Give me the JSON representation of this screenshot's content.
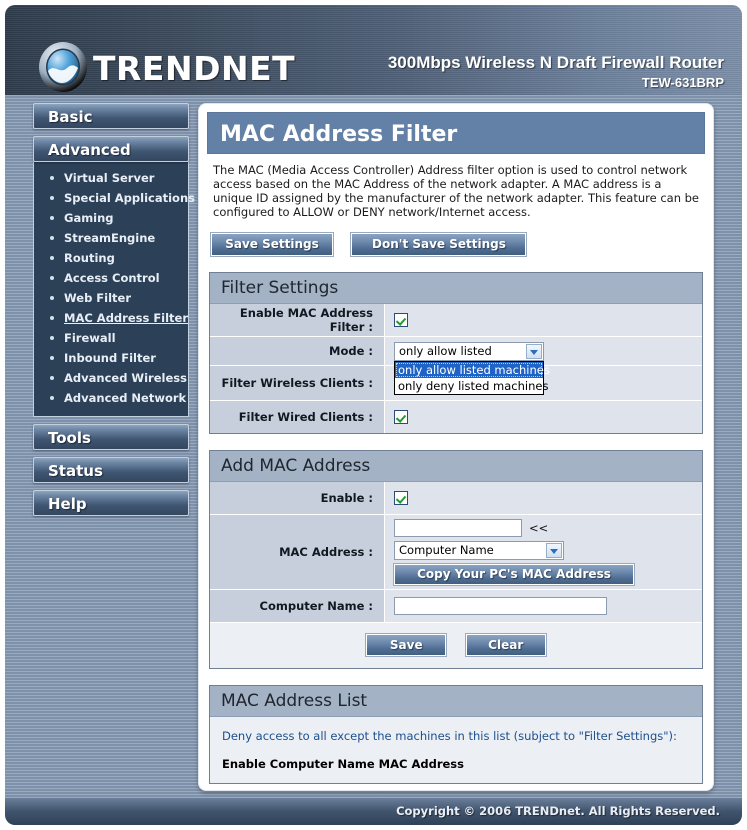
{
  "header": {
    "brand": "TRENDNET",
    "product_line": "300Mbps Wireless N Draft Firewall Router",
    "model": "TEW-631BRP"
  },
  "sidebar": {
    "buttons": [
      {
        "label": "Basic"
      },
      {
        "label": "Advanced"
      },
      {
        "label": "Tools"
      },
      {
        "label": "Status"
      },
      {
        "label": "Help"
      }
    ],
    "advanced_items": [
      {
        "label": "Virtual Server",
        "active": false
      },
      {
        "label": "Special Applications",
        "active": false
      },
      {
        "label": "Gaming",
        "active": false
      },
      {
        "label": "StreamEngine",
        "active": false
      },
      {
        "label": "Routing",
        "active": false
      },
      {
        "label": "Access Control",
        "active": false
      },
      {
        "label": "Web Filter",
        "active": false
      },
      {
        "label": "MAC Address Filter",
        "active": true
      },
      {
        "label": "Firewall",
        "active": false
      },
      {
        "label": "Inbound Filter",
        "active": false
      },
      {
        "label": "Advanced Wireless",
        "active": false
      },
      {
        "label": "Advanced Network",
        "active": false
      }
    ]
  },
  "page": {
    "title": "MAC Address Filter",
    "description": "The MAC (Media Access Controller) Address filter option is used to control network access based on the MAC Address of the network adapter. A MAC address is a unique ID assigned by the manufacturer of the network adapter. This feature can be configured to ALLOW or DENY network/Internet access.",
    "save_settings_label": "Save Settings",
    "dont_save_settings_label": "Don't Save Settings"
  },
  "filter_settings": {
    "title": "Filter Settings",
    "enable_filter_label": "Enable MAC Address Filter :",
    "enable_filter_checked": true,
    "mode_label": "Mode :",
    "mode_value": "only allow listed machines",
    "mode_options": [
      {
        "label": "only allow listed machines",
        "selected": true
      },
      {
        "label": "only deny listed machines",
        "selected": false
      }
    ],
    "filter_wireless_label": "Filter Wireless Clients :",
    "filter_wired_label": "Filter Wired Clients :",
    "filter_wired_checked": true
  },
  "add_mac": {
    "title": "Add MAC Address",
    "enable_label": "Enable :",
    "enable_checked": true,
    "mac_address_label": "MAC Address :",
    "mac_address_value": "",
    "copy_arrow_label": "<<",
    "computer_select_value": "Computer Name",
    "copy_button_label": "Copy Your PC's MAC Address",
    "computer_name_label": "Computer Name :",
    "computer_name_value": "",
    "save_label": "Save",
    "clear_label": "Clear"
  },
  "mac_list": {
    "title": "MAC Address List",
    "note": "Deny access to all except the machines in this list (subject to \"Filter Settings\"):",
    "columns": "Enable Computer Name MAC Address"
  },
  "footer": {
    "copyright": "Copyright © 2006 TRENDnet. All Rights Reserved."
  }
}
